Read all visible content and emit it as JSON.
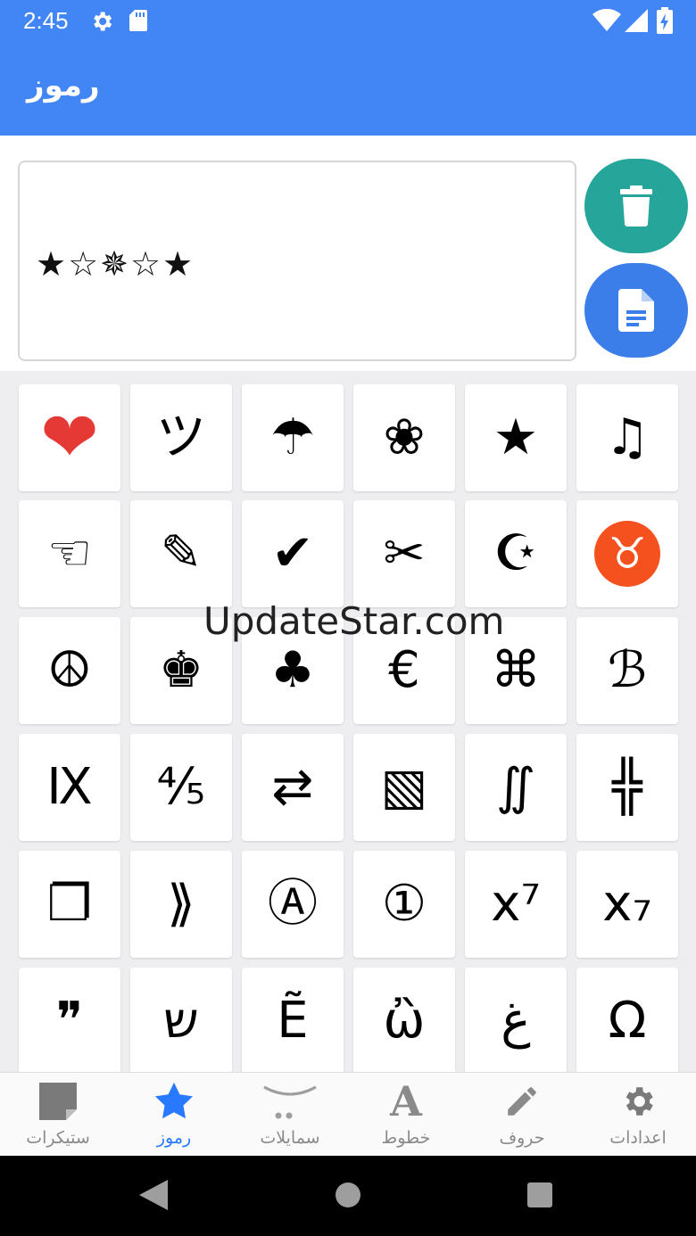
{
  "status_bar": {
    "time": "2:45",
    "icons": [
      "gear-icon",
      "sd-card-icon",
      "wifi-icon",
      "signal-icon",
      "battery-charging-icon"
    ]
  },
  "app_bar": {
    "title": "رموز"
  },
  "editor": {
    "text": "★☆✵☆★",
    "delete_icon": "trash-icon",
    "copy_icon": "document-icon",
    "colors": {
      "delete": "#26a69a",
      "copy": "#3b7de9"
    }
  },
  "symbols": [
    [
      "❤",
      "ツ",
      "☂",
      "❀",
      "★",
      "♫"
    ],
    [
      "☜",
      "✎",
      "✔",
      "✂",
      "☪",
      "♉"
    ],
    [
      "☮",
      "♚",
      "♣",
      "€",
      "⌘",
      "ℬ"
    ],
    [
      "Ⅸ",
      "⅘",
      "⇄",
      "▧",
      "∬",
      "╬"
    ],
    [
      "❐",
      "⟫",
      "Ⓐ",
      "①",
      "x⁷",
      "x₇"
    ],
    [
      "❞",
      "ש",
      "Ẽ",
      "ὢ",
      "غ",
      "Ω"
    ]
  ],
  "watermark": "UpdateStar.com",
  "bottom_nav": {
    "items": [
      {
        "label": "ستيكرات",
        "icon": "sticker-icon"
      },
      {
        "label": "رموز",
        "icon": "star-icon"
      },
      {
        "label": "سمايلات",
        "icon": "smile-icon"
      },
      {
        "label": "خطوط",
        "icon": "font-icon"
      },
      {
        "label": "حروف",
        "icon": "pencil-icon"
      },
      {
        "label": "اعدادات",
        "icon": "settings-icon"
      }
    ],
    "active_color": "#2979ff"
  },
  "colors": {
    "primary": "#4285f4"
  }
}
